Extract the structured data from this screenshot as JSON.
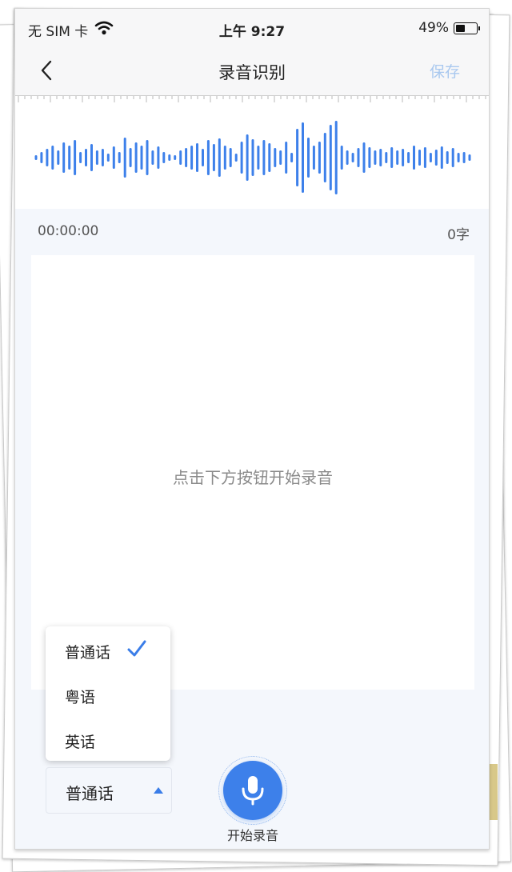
{
  "status": {
    "carrier": "无 SIM 卡",
    "time": "上午 9:27",
    "battery": "49%"
  },
  "nav": {
    "title": "录音识别",
    "save_label": "保存"
  },
  "recorder": {
    "elapsed": "00:00:00",
    "char_count": "0字",
    "hint": "点击下方按钮开始录音"
  },
  "language": {
    "options": [
      "普通话",
      "粤语",
      "英话"
    ],
    "selected": "普通话"
  },
  "record_button": {
    "label": "开始录音"
  },
  "colors": {
    "accent": "#3d80ea",
    "save_disabled": "#a9c8ef"
  },
  "icons": [
    "back-chevron-icon",
    "wifi-icon",
    "battery-icon",
    "checkmark-icon",
    "triangle-up-icon",
    "microphone-icon"
  ]
}
